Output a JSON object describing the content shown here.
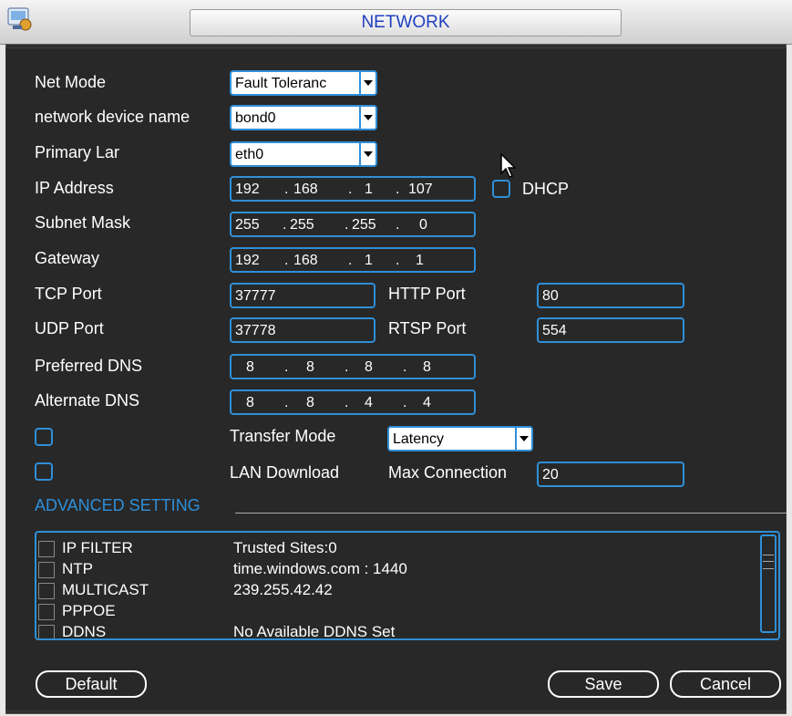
{
  "window": {
    "title": "NETWORK",
    "app_icon": "network-settings-icon"
  },
  "form": {
    "net_mode": {
      "label": "Net Mode",
      "value": "Fault Toleranc"
    },
    "device_name": {
      "label": "network device name",
      "value": "bond0"
    },
    "primary_lan": {
      "label": "Primary Lar",
      "value": "eth0"
    },
    "ip_address": {
      "label": "IP Address",
      "octets": [
        "192",
        "168",
        "1",
        "107"
      ]
    },
    "dhcp": {
      "label": "DHCP",
      "checked": false
    },
    "subnet_mask": {
      "label": "Subnet Mask",
      "octets": [
        "255",
        "255",
        "255",
        "0"
      ]
    },
    "gateway": {
      "label": "Gateway",
      "octets": [
        "192",
        "168",
        "1",
        "1"
      ]
    },
    "tcp_port": {
      "label": "TCP Port",
      "value": "37777"
    },
    "http_port": {
      "label": "HTTP Port",
      "value": "80"
    },
    "udp_port": {
      "label": "UDP Port",
      "value": "37778"
    },
    "rtsp_port": {
      "label": "RTSP Port",
      "value": "554"
    },
    "preferred_dns": {
      "label": "Preferred DNS",
      "octets": [
        "8",
        "8",
        "8",
        "8"
      ]
    },
    "alternate_dns": {
      "label": "Alternate DNS",
      "octets": [
        "8",
        "8",
        "4",
        "4"
      ]
    },
    "transfer_mode": {
      "label": "Transfer Mode",
      "value": "Latency",
      "checked": false
    },
    "lan_download": {
      "label": "LAN Download",
      "checked": false
    },
    "max_connection": {
      "label": "Max Connection",
      "value": "20"
    }
  },
  "advanced": {
    "title": "ADVANCED SETTING",
    "items": [
      {
        "name": "IP FILTER",
        "value": "Trusted Sites:0"
      },
      {
        "name": "NTP",
        "value": "time.windows.com : 1440"
      },
      {
        "name": "MULTICAST",
        "value": "239.255.42.42"
      },
      {
        "name": "PPPOE",
        "value": ""
      },
      {
        "name": "DDNS",
        "value": "No Available DDNS Set"
      }
    ]
  },
  "buttons": {
    "default": "Default",
    "save": "Save",
    "cancel": "Cancel"
  },
  "colors": {
    "accent": "#2f8fd8",
    "panel": "#282828",
    "title_text": "#1f3fbf"
  }
}
